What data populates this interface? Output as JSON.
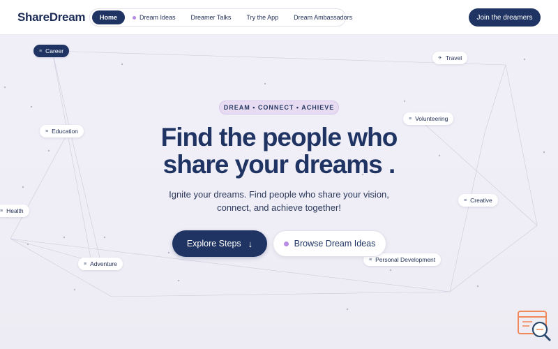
{
  "brand": {
    "name": "ShareDream"
  },
  "nav": {
    "items": [
      {
        "label": "Home",
        "active": true
      },
      {
        "label": "Dream Ideas",
        "active": false
      },
      {
        "label": "Dreamer Talks",
        "active": false
      },
      {
        "label": "Try the App",
        "active": false
      },
      {
        "label": "Dream Ambassadors",
        "active": false
      }
    ]
  },
  "header": {
    "join_label": "Join the dreamers"
  },
  "hero": {
    "badge": "DREAM • CONNECT • ACHIEVE",
    "headline_line1": "Find the people who",
    "headline_line2": "share your dreams .",
    "sub_line1": "Ignite your dreams. Find people who share your vision,",
    "sub_line2": "connect, and achieve together!",
    "primary_button": "Explore Steps",
    "secondary_button": "Browse Dream Ideas"
  },
  "tags": {
    "career": "Career",
    "travel": "Travel",
    "education": "Education",
    "volunteering": "Volunteering",
    "health": "Health",
    "creative": "Creative",
    "adventure": "Adventure",
    "personal_development": "Personal Development"
  },
  "colors": {
    "navy": "#1f3462",
    "purple_accent": "#b58be3",
    "badge_bg": "#e7dcf2",
    "corner_icon": "#f08a5d"
  },
  "icons": {
    "arrow": "arrow-down-icon",
    "tag_icon": "bars-icon",
    "travel_icon": "plane-icon",
    "corner": "search-document-icon"
  }
}
